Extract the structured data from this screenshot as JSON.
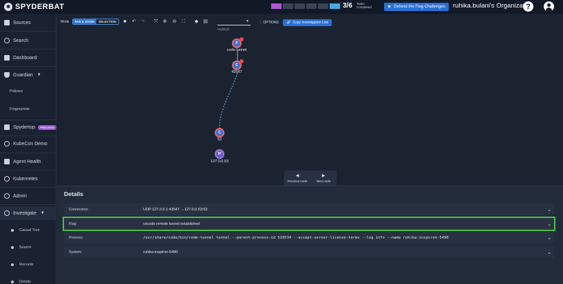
{
  "app": {
    "name": "SPYDERBAT"
  },
  "header": {
    "tasks_count": "3/6",
    "tasks_label": "Tasks Completed",
    "progress": {
      "completed": 3,
      "total": 6
    },
    "flag_button": "Defend the Flag Challenges",
    "org_name": "ruhika.bulani's Organization"
  },
  "sidebar": {
    "sources": "Sources",
    "search": "Search",
    "dashboard": "Dashboard",
    "guardian": "Guardian",
    "policies": "Policies",
    "fingerprints": "Fingerprints",
    "spydertop": "Spydertop",
    "spydertop_badge": "PREVIEW",
    "kubecon": "KubeCon Demo",
    "agent_health": "Agent Health",
    "kubernetes": "Kubernetes",
    "admin": "Admin",
    "investigate": "Investigate",
    "causal_tree": "Causal Tree",
    "inv_search": "Search",
    "records": "Records",
    "details": "Details"
  },
  "toolbar": {
    "mode_label": "Mode",
    "pan_zoom": "PAN & ZOOM",
    "selection": "SELECTION",
    "highlight_label": "Highlight",
    "options": "OPTIONS",
    "copy_link": "Copy Investigation Link"
  },
  "graph": {
    "nodes": [
      {
        "glyph": "P",
        "label": "code-tunnel",
        "alert": "!"
      },
      {
        "glyph": "C",
        "label": "43547",
        "alert": "!"
      },
      {
        "glyph": "C",
        "label": "53"
      },
      {
        "glyph": "IP",
        "label": "127.0.0.53"
      }
    ],
    "prev_node": "Previous node",
    "next_node": "Next node"
  },
  "details": {
    "title": "Details",
    "rows": [
      {
        "key": "Connection",
        "value": "UDP 127.0.0.1:43547 →127.0.0.53:53"
      },
      {
        "key": "Flag",
        "value": "vscode remote tunnel established"
      },
      {
        "key": "Process",
        "value": "/usr/share/code/bin/code-tunnel tunnel --parent-process-id 519534 --accept-server-license-terms --log info --name ruhika-inspiron-5490"
      },
      {
        "key": "System",
        "value": "ruhika-inspiron-5490"
      }
    ]
  },
  "colors": {
    "accent": "#2a6fd8",
    "highlight": "#4ac33e",
    "badge": "#9a55d6"
  }
}
